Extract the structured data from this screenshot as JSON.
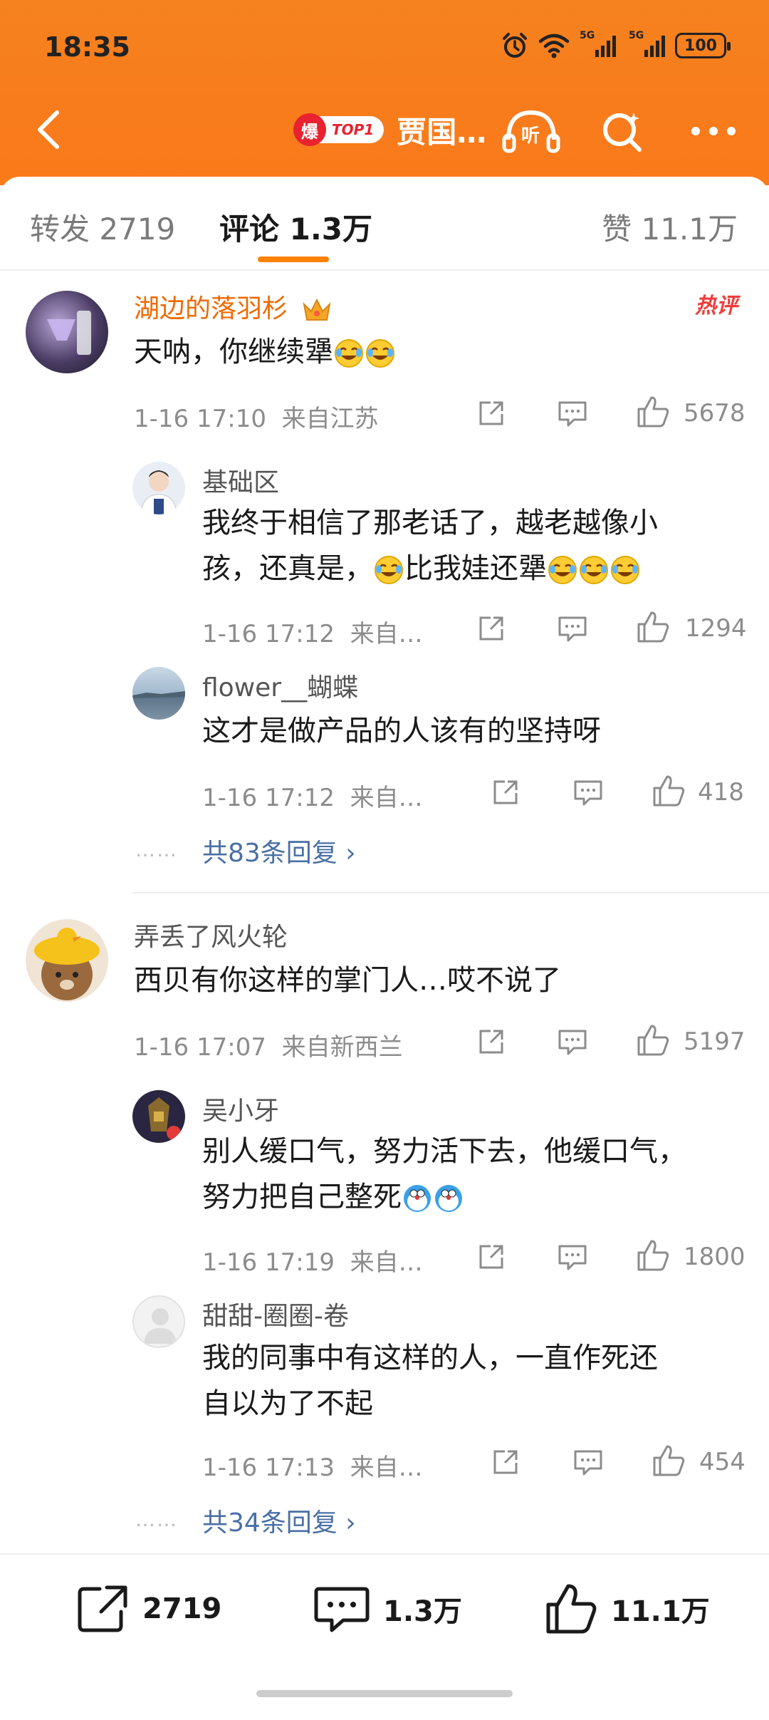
{
  "status_bar": {
    "time": "18:35",
    "network_1": "5G",
    "network_2": "5G",
    "battery": "100",
    "icons": [
      "alarm-icon",
      "wifi-icon",
      "signal-icon",
      "signal-icon",
      "battery-icon"
    ]
  },
  "nav": {
    "hot_badge_char": "爆",
    "hot_badge_text": "TOP1",
    "title": "贾国…",
    "listen_label": "听",
    "colors": {
      "header": "#f87c1c",
      "accent": "#ff8200",
      "hot": "#e8232f"
    }
  },
  "tabs": [
    {
      "label": "转发 2719"
    },
    {
      "label": "评论 1.3万"
    },
    {
      "label": "赞 11.1万"
    }
  ],
  "comments": [
    {
      "user": "湖边的落羽杉",
      "hot_tag": "热评",
      "text": "天呐，你继续犟",
      "time": "1-16 17:10",
      "location": "来自江苏",
      "likes": "5678",
      "replies": [
        {
          "user": "基础区",
          "text_line1": "我终于相信了那老话了，越老越像小",
          "text_line2a": "孩，还真是，",
          "text_line2b": "比我娃还犟",
          "time": "1-16 17:12",
          "location": "来自…",
          "likes": "1294"
        },
        {
          "user": "flower__蝴蝶",
          "text_line1": "这才是做产品的人该有的坚持呀",
          "time": "1-16 17:12",
          "location": "来自…",
          "likes": "418"
        }
      ],
      "more_dots": "……",
      "more_replies": "共83条回复 ›"
    },
    {
      "user": "弄丢了风火轮",
      "text": "西贝有你这样的掌门人…哎不说了",
      "time": "1-16 17:07",
      "location": "来自新西兰",
      "likes": "5197",
      "replies": [
        {
          "user": "吴小牙",
          "text_line1": "别人缓口气，努力活下去，他缓口气，",
          "text_line2a": "努力把自己整死",
          "time": "1-16 17:19",
          "location": "来自…",
          "likes": "1800"
        },
        {
          "user": "甜甜-圈圈-卷",
          "text_line1": "我的同事中有这样的人，一直作死还",
          "text_line2a": "自以为了不起",
          "time": "1-16 17:13",
          "location": "来自…",
          "likes": "454"
        }
      ],
      "more_dots": "……",
      "more_replies": "共34条回复 ›"
    }
  ],
  "bottom_bar": {
    "repost": "2719",
    "comment": "1.3万",
    "like": "11.1万"
  }
}
